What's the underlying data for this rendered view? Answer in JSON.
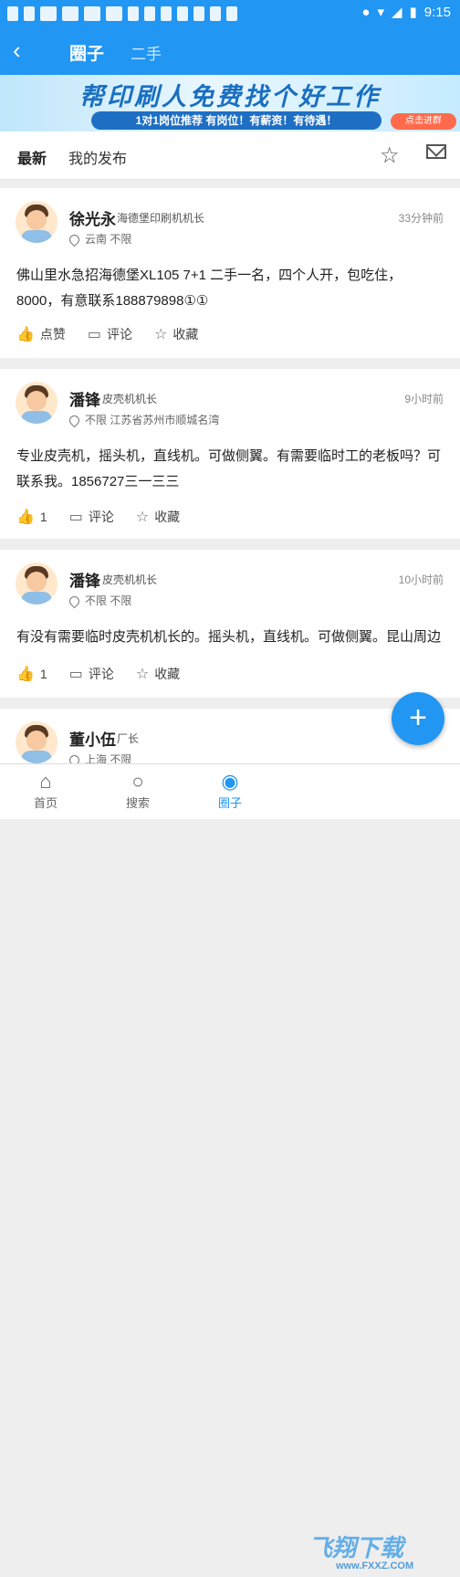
{
  "status": {
    "time": "9:15"
  },
  "header": {
    "back_icon": "back-arrow-icon",
    "tab_active": "圈子",
    "tab_inactive": "二手"
  },
  "banner": {
    "title": "帮印刷人免费找个好工作",
    "subtitle": "1对1岗位推荐  有岗位！有薪资！有待遇！",
    "cta": "点击进群"
  },
  "filter": {
    "latest": "最新",
    "mine": "我的发布"
  },
  "posts": [
    {
      "name": "徐光永",
      "role": "海德堡印刷机机长",
      "time": "33分钟前",
      "location": "云南  不限",
      "content": "佛山里水急招海德堡XL105   7+1     二手一名，四个人开，包吃住，8000，有意联系188879898①①",
      "like": "点赞",
      "comment": "评论",
      "fav": "收藏"
    },
    {
      "name": "潘锋",
      "role": "皮壳机机长",
      "time": "9小时前",
      "location": "不限  江苏省苏州市顺城名湾",
      "content": "专业皮壳机，摇头机，直线机。可做侧翼。有需要临时工的老板吗？可联系我。1856727三一三三",
      "like": "1",
      "comment": "评论",
      "fav": "收藏"
    },
    {
      "name": "潘锋",
      "role": "皮壳机机长",
      "time": "10小时前",
      "location": "不限  不限",
      "content": "有没有需要临时皮壳机机长的。摇头机，直线机。可做侧翼。昆山周边",
      "like": "1",
      "comment": "评论",
      "fav": "收藏"
    },
    {
      "name": "董小伍",
      "role": "厂长",
      "time": "",
      "location": "上海  不限",
      "content": "",
      "like": "",
      "comment": "",
      "fav": ""
    }
  ],
  "nav": {
    "home": "首页",
    "search": "搜索",
    "circle": "圈子"
  },
  "watermark": {
    "text": "飞翔下载",
    "url": "www.FXXZ.COM"
  },
  "colors": {
    "primary": "#2196f3"
  }
}
